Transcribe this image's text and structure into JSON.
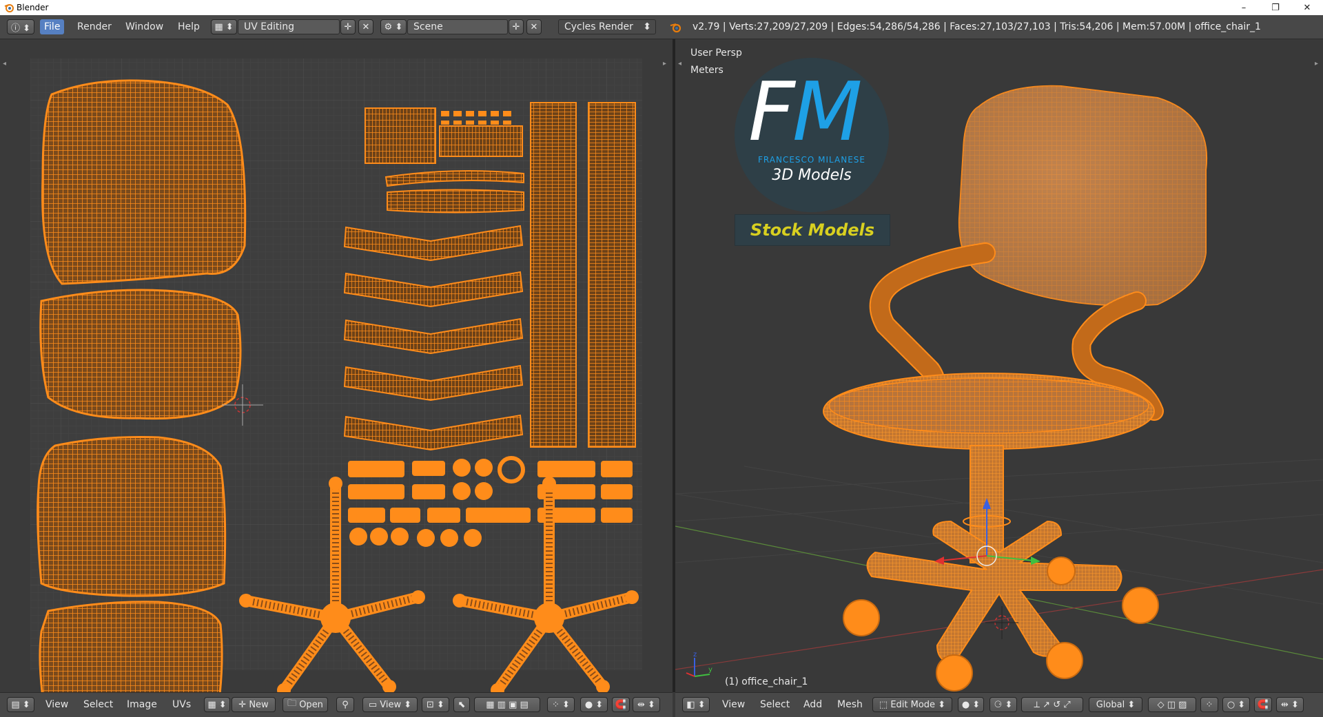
{
  "window": {
    "title": "Blender",
    "controls": [
      "–",
      "❐",
      "✕"
    ]
  },
  "topbar": {
    "menus": [
      "File",
      "Render",
      "Window",
      "Help"
    ],
    "active_menu": "File",
    "screen_layout": "UV Editing",
    "scene": "Scene",
    "render_engine": "Cycles Render",
    "stats": "v2.79 | Verts:27,209/27,209 | Edges:54,286/54,286 | Faces:27,103/27,103 | Tris:54,206 | Mem:57.00M | office_chair_1"
  },
  "uv_editor": {
    "header_menus": [
      "View",
      "Select",
      "Image",
      "UVs"
    ],
    "new_label": "New",
    "open_label": "Open",
    "view_label": "View"
  },
  "viewport": {
    "perspective": "User Persp",
    "units": "Meters",
    "object_label": "(1) office_chair_1",
    "header_menus": [
      "View",
      "Select",
      "Add",
      "Mesh"
    ],
    "mode": "Edit Mode",
    "orientation": "Global"
  },
  "watermark": {
    "logo_letters": "FM",
    "brand": "FRANCESCO MILANESE",
    "tagline": "3D Models",
    "stock_label": "Stock Models"
  },
  "colors": {
    "wire": "#ff8c1a",
    "wire_dark": "#b35a00",
    "brand_blue": "#1ea0e6",
    "stock_yellow": "#d8d020",
    "menu_active": "#5680c2"
  }
}
